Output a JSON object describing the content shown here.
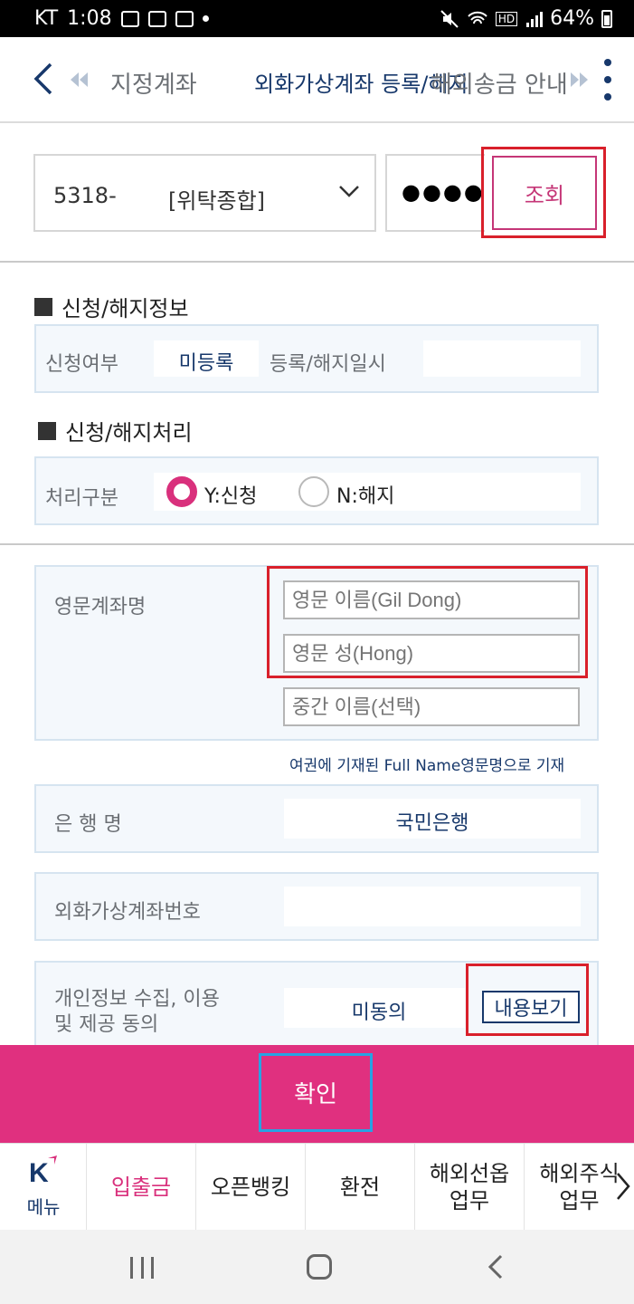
{
  "status_bar": {
    "carrier": "KT",
    "time": "1:08",
    "battery": "64%"
  },
  "tabs": [
    {
      "label": "지정계좌"
    },
    {
      "label": "외화가상계좌 등록/해지"
    },
    {
      "label": "해외송금 안내"
    }
  ],
  "account": {
    "number": "5318-",
    "type": "[위탁종합]",
    "password_mask": "●●●●",
    "query_label": "조회"
  },
  "apply_info": {
    "title": "신청/해지정보",
    "status_label": "신청여부",
    "status_value": "미등록",
    "datetime_label": "등록/해지일시",
    "datetime_value": ""
  },
  "process": {
    "title": "신청/해지처리",
    "type_label": "처리구분",
    "options": [
      {
        "label": "Y:신청",
        "selected": true
      },
      {
        "label": "N:해지",
        "selected": false
      }
    ]
  },
  "english_name": {
    "label": "영문계좌명",
    "first_placeholder": "영문 이름(Gil Dong)",
    "last_placeholder": "영문 성(Hong)",
    "middle_placeholder": "중간 이름(선택)",
    "hint": "여권에 기재된 Full Name영문명으로 기재"
  },
  "bank": {
    "label": "은 행 명",
    "value": "국민은행"
  },
  "virtual_account": {
    "label": "외화가상계좌번호",
    "value": ""
  },
  "consent": {
    "label_line1": "개인정보 수집, 이용",
    "label_line2": "및 제공 동의",
    "value": "미동의",
    "view_label": "내용보기"
  },
  "confirm_label": "확인",
  "bottom_nav": {
    "menu_label": "메뉴",
    "items": [
      {
        "line1": "입출금",
        "line2": ""
      },
      {
        "line1": "오픈뱅킹",
        "line2": ""
      },
      {
        "line1": "환전",
        "line2": ""
      },
      {
        "line1": "해외선옵",
        "line2": "업무"
      },
      {
        "line1": "해외주식",
        "line2": "업무"
      }
    ]
  },
  "colors": {
    "brand_pink": "#e0307f",
    "navy": "#17386b",
    "highlight_red": "#d9202b",
    "highlight_blue": "#27a3e3"
  }
}
